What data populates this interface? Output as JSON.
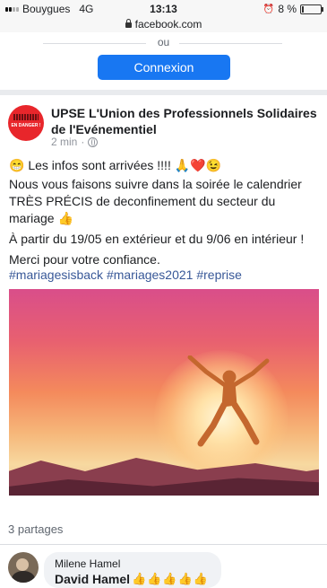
{
  "status_bar": {
    "carrier": "Bouygues",
    "network": "4G",
    "time": "13:13",
    "battery": "8 %"
  },
  "browser": {
    "url": "facebook.com"
  },
  "login": {
    "or_label": "ou",
    "connect_label": "Connexion"
  },
  "post": {
    "page_name": "UPSE L'Union des Professionnels Solidaires de l'Evénementiel",
    "avatar_text": "EN DANGER !",
    "time": "2 min",
    "line1": "😁 Les infos sont arrivées !!!! 🙏❤️😉",
    "line2": "Nous vous faisons suivre dans la soirée le calendrier TRÈS PRÉCIS de deconfinement du secteur du mariage 👍",
    "line3": "À partir du 19/05 en extérieur et du 9/06 en intérieur !",
    "line4": "Merci pour votre confiance.",
    "hashtags": "#mariagesisback #mariages2021 #reprise",
    "shares": "3 partages"
  },
  "comment": {
    "author": "Milene Hamel",
    "text": "David Hamel",
    "reaction": "👍👍👍👍👍"
  },
  "colors": {
    "facebook_blue": "#1877f2",
    "link_blue": "#385898",
    "avatar_red": "#e8262b"
  }
}
